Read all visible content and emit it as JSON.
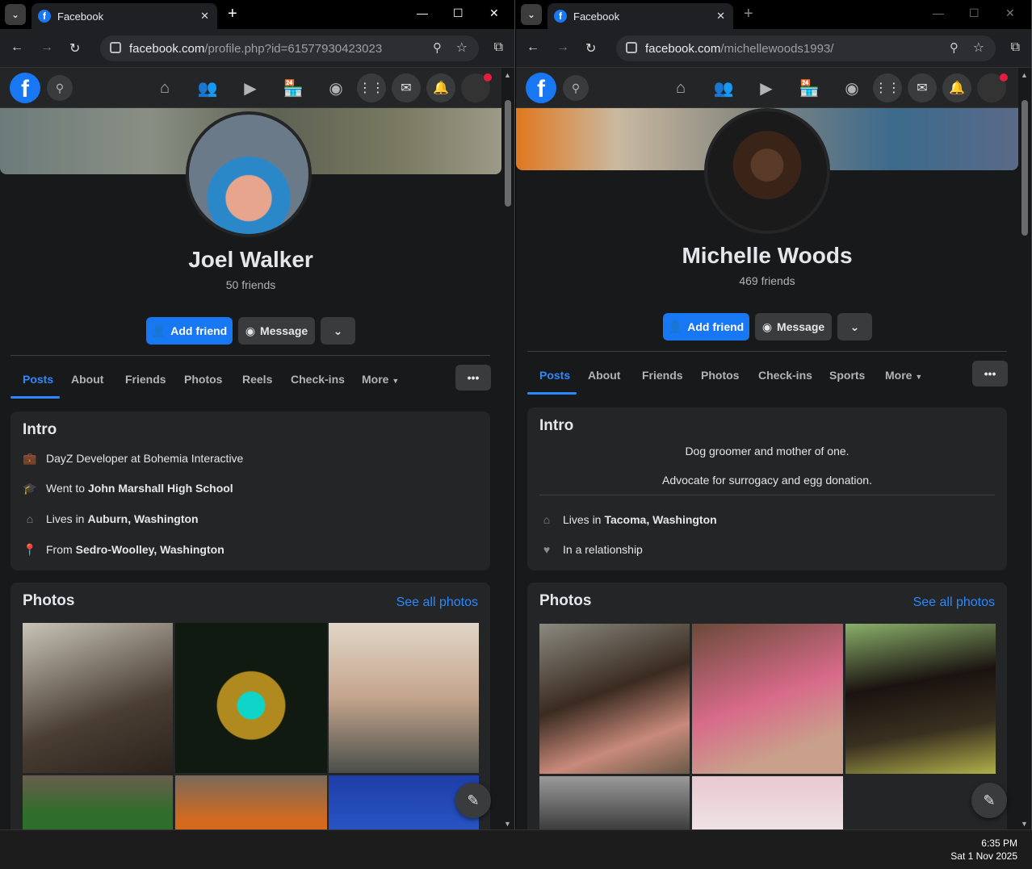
{
  "windows": [
    {
      "tab_title": "Facebook",
      "url_domain": "facebook.com",
      "url_path": "/profile.php?id=61577930423023",
      "profile": {
        "name": "Joel Walker",
        "friends": "50 friends",
        "add_friend": "Add friend",
        "message": "Message",
        "tabs": [
          "Posts",
          "About",
          "Friends",
          "Photos",
          "Reels",
          "Check-ins",
          "More"
        ],
        "intro_title": "Intro",
        "intro": [
          {
            "icon": "briefcase-icon",
            "text": "DayZ Developer at Bohemia Interactive",
            "bold": ""
          },
          {
            "icon": "graduation-cap-icon",
            "text": "Went to",
            "bold": "John Marshall High School"
          },
          {
            "icon": "home-icon",
            "text": "Lives in",
            "bold": "Auburn, Washington"
          },
          {
            "icon": "location-pin-icon",
            "text": "From",
            "bold": "Sedro-Woolley, Washington"
          }
        ],
        "photos_title": "Photos",
        "see_all": "See all photos"
      }
    },
    {
      "tab_title": "Facebook",
      "url_domain": "facebook.com",
      "url_path": "/michellewoods1993/",
      "profile": {
        "name": "Michelle Woods",
        "friends": "469 friends",
        "add_friend": "Add friend",
        "message": "Message",
        "tabs": [
          "Posts",
          "About",
          "Friends",
          "Photos",
          "Check-ins",
          "Sports",
          "More"
        ],
        "intro_title": "Intro",
        "bio": [
          "Dog groomer and mother of one.",
          "Advocate for surrogacy and egg donation."
        ],
        "intro": [
          {
            "icon": "home-icon",
            "text": "Lives in",
            "bold": "Tacoma, Washington"
          },
          {
            "icon": "heart-icon",
            "text": "In a relationship",
            "bold": ""
          }
        ],
        "photos_title": "Photos",
        "see_all": "See all photos"
      }
    }
  ],
  "taskbar": {
    "time": "6:35 PM",
    "date": "Sat 1 Nov 2025"
  },
  "colors": {
    "accent": "#1877f2",
    "link": "#2d88ff",
    "bg": "#18191a",
    "card": "#242526"
  }
}
